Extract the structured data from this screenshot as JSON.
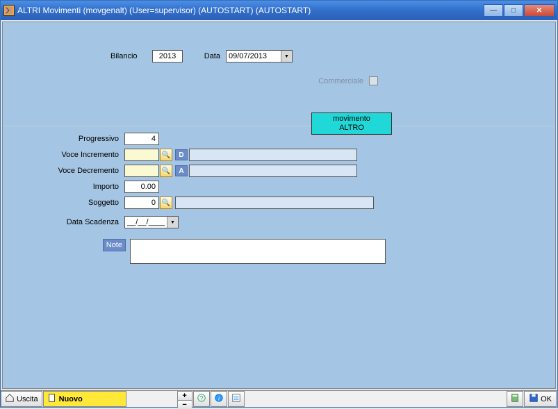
{
  "window": {
    "title": "ALTRI Movimenti   (movgenalt)   (User=supervisor) (AUTOSTART) (AUTOSTART)"
  },
  "header": {
    "bilancio_label": "Bilancio",
    "bilancio_value": "2013",
    "data_label": "Data",
    "data_value": "09/07/2013",
    "commerciale_label": "Commerciale"
  },
  "status": {
    "line1": "movimento",
    "line2": "ALTRO"
  },
  "form": {
    "progressivo_label": "Progressivo",
    "progressivo_value": "4",
    "voce_incremento_label": "Voce Incremento",
    "voce_incremento_code": "",
    "voce_incremento_badge": "D",
    "voce_incremento_desc": "",
    "voce_decremento_label": "Voce Decremento",
    "voce_decremento_code": "",
    "voce_decremento_badge": "A",
    "voce_decremento_desc": "",
    "importo_label": "Importo",
    "importo_value": "0.00",
    "soggetto_label": "Soggetto",
    "soggetto_value": "0",
    "soggetto_desc": "",
    "data_scadenza_label": "Data Scadenza",
    "data_scadenza_value": "__/__/____",
    "note_label": "Note",
    "note_value": ""
  },
  "toolbar": {
    "uscita_label": "Uscita",
    "nuovo_label": "Nuovo",
    "ok_label": "OK"
  }
}
